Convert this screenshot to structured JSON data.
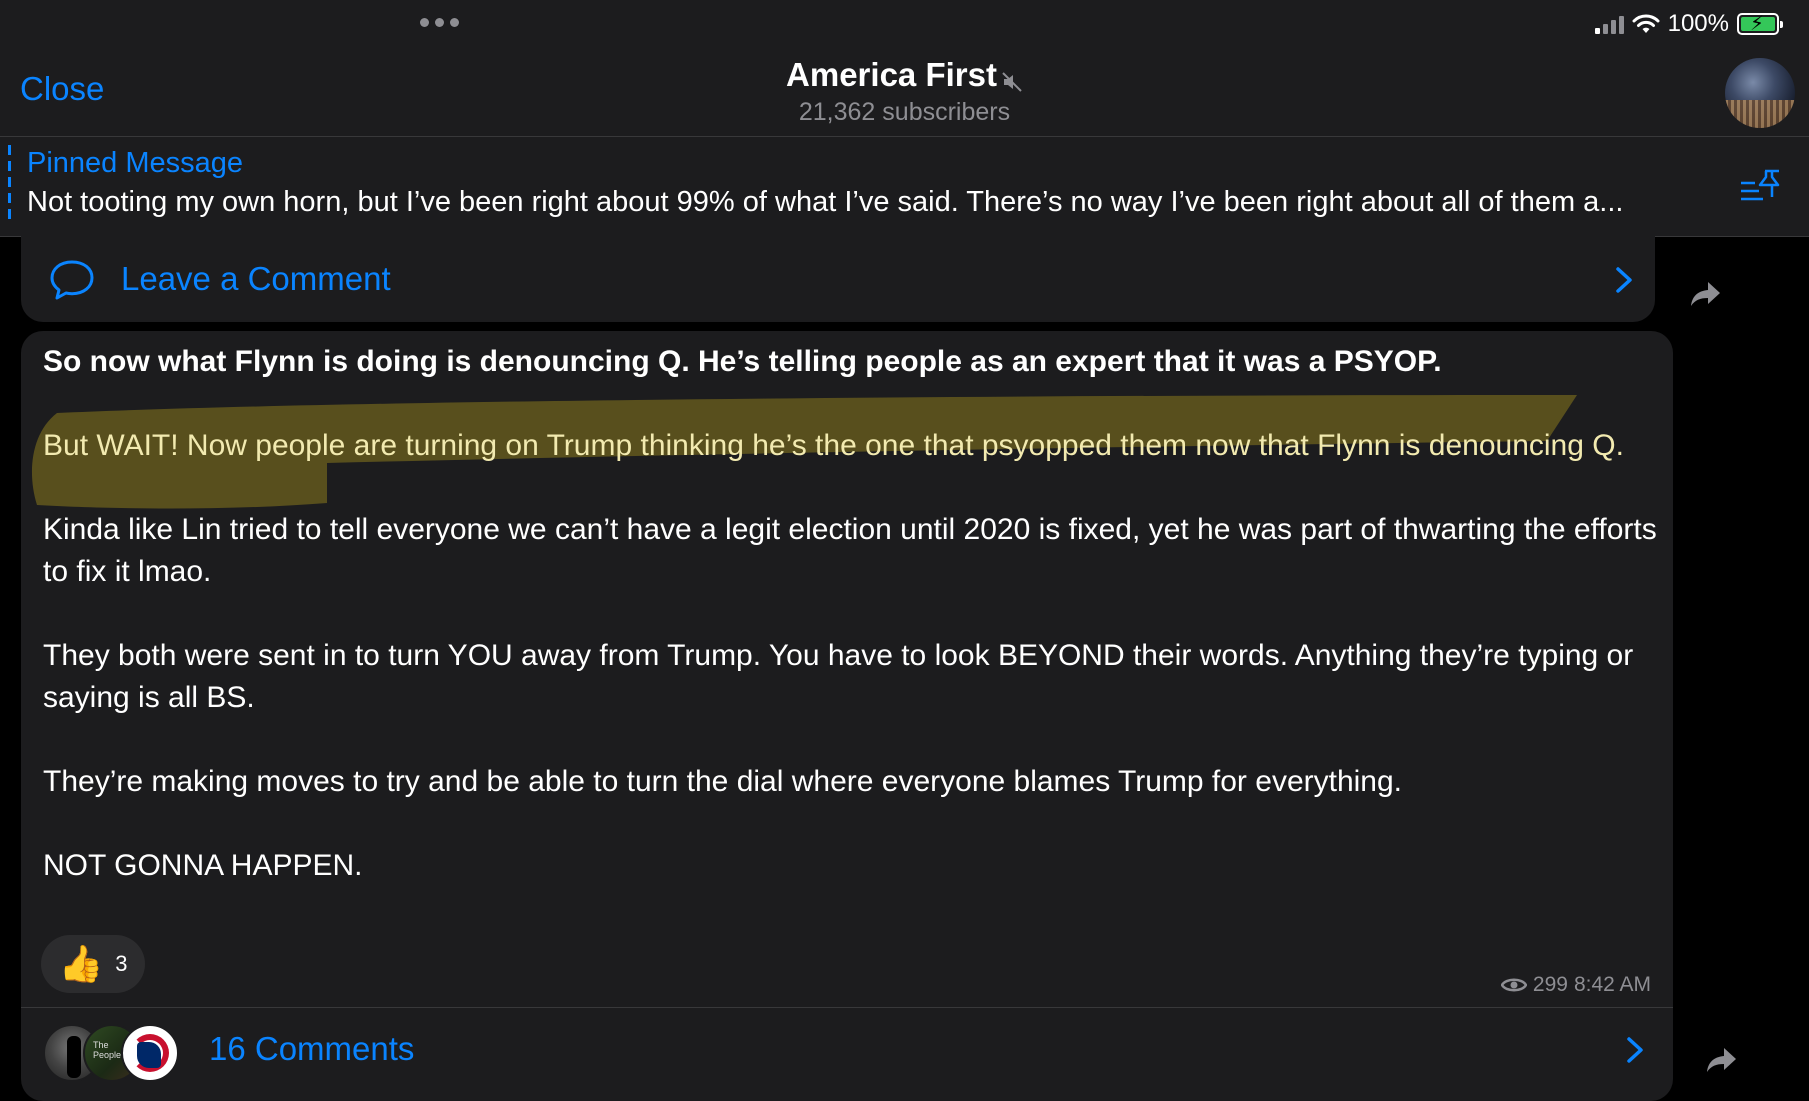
{
  "status_bar": {
    "battery_percent": "100%",
    "battery_charging": true
  },
  "header": {
    "close_label": "Close",
    "title": "America First",
    "subtitle": "21,362 subscribers",
    "muted": true
  },
  "pinned": {
    "title": "Pinned Message",
    "text": "Not tooting my own horn, but I’ve been right about 99% of what I’ve said. There’s no way I’ve been right about all of them a..."
  },
  "previous_post": {
    "comment_action": "Leave a Comment"
  },
  "message": {
    "paragraphs": [
      "So now what Flynn is doing is denouncing Q. He’s telling people as an expert that it was a PSYOP.",
      "But WAIT! Now people are turning on Trump thinking he’s the one that psyopped them now that Flynn is denouncing Q.",
      "Kinda like Lin tried to tell everyone we can’t have a legit election until 2020 is fixed, yet he was part of thwarting the efforts to fix it lmao.",
      "They both were sent in to turn YOU away from Trump. You have to look BEYOND their words. Anything they’re typing or saying is all BS.",
      "They’re making moves to try and be able to turn the dial where everyone blames Trump for everything.",
      "NOT GONNA HAPPEN."
    ],
    "reaction": {
      "emoji": "👍",
      "count": "3"
    },
    "views": "299",
    "time": "8:42 AM",
    "comments_label": "16 Comments",
    "commenter_avatar_text": "The People"
  },
  "colors": {
    "accent": "#0a84ff",
    "background": "#000000",
    "surface": "#1c1c1e",
    "highlight": "#8a7a1e"
  }
}
